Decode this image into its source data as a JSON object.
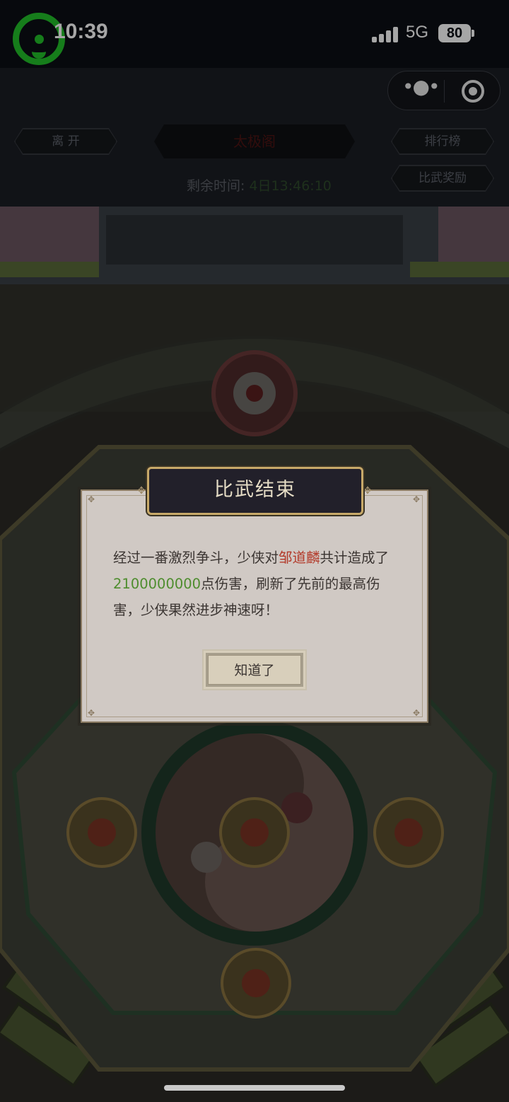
{
  "status_bar": {
    "time": "10:39",
    "network": "5G",
    "battery": "80"
  },
  "header": {
    "leave_label": "离 开",
    "arena_title": "太极阁",
    "ranking_label": "排行榜",
    "reward_label": "比武奖励",
    "remaining_label": "剩余时间:",
    "remaining_value": "4日13:46:10"
  },
  "dialog": {
    "title": "比武结束",
    "text_part1": "经过一番激烈争斗，少侠对",
    "opponent": "邹道麟",
    "text_part2": "共计造成了",
    "damage": "2100000000",
    "text_part3": "点伤害，刷新了先前的最高伤害，少侠果然进步神速呀！",
    "ok_label": "知道了"
  },
  "icons": [
    "wechat-logo-icon",
    "signal-icon",
    "battery-icon",
    "more-icon",
    "close-capsule-icon"
  ],
  "colors": {
    "accent_gold": "#c7a969",
    "highlight_red": "#b33a2a",
    "highlight_green": "#4e8d2e"
  }
}
